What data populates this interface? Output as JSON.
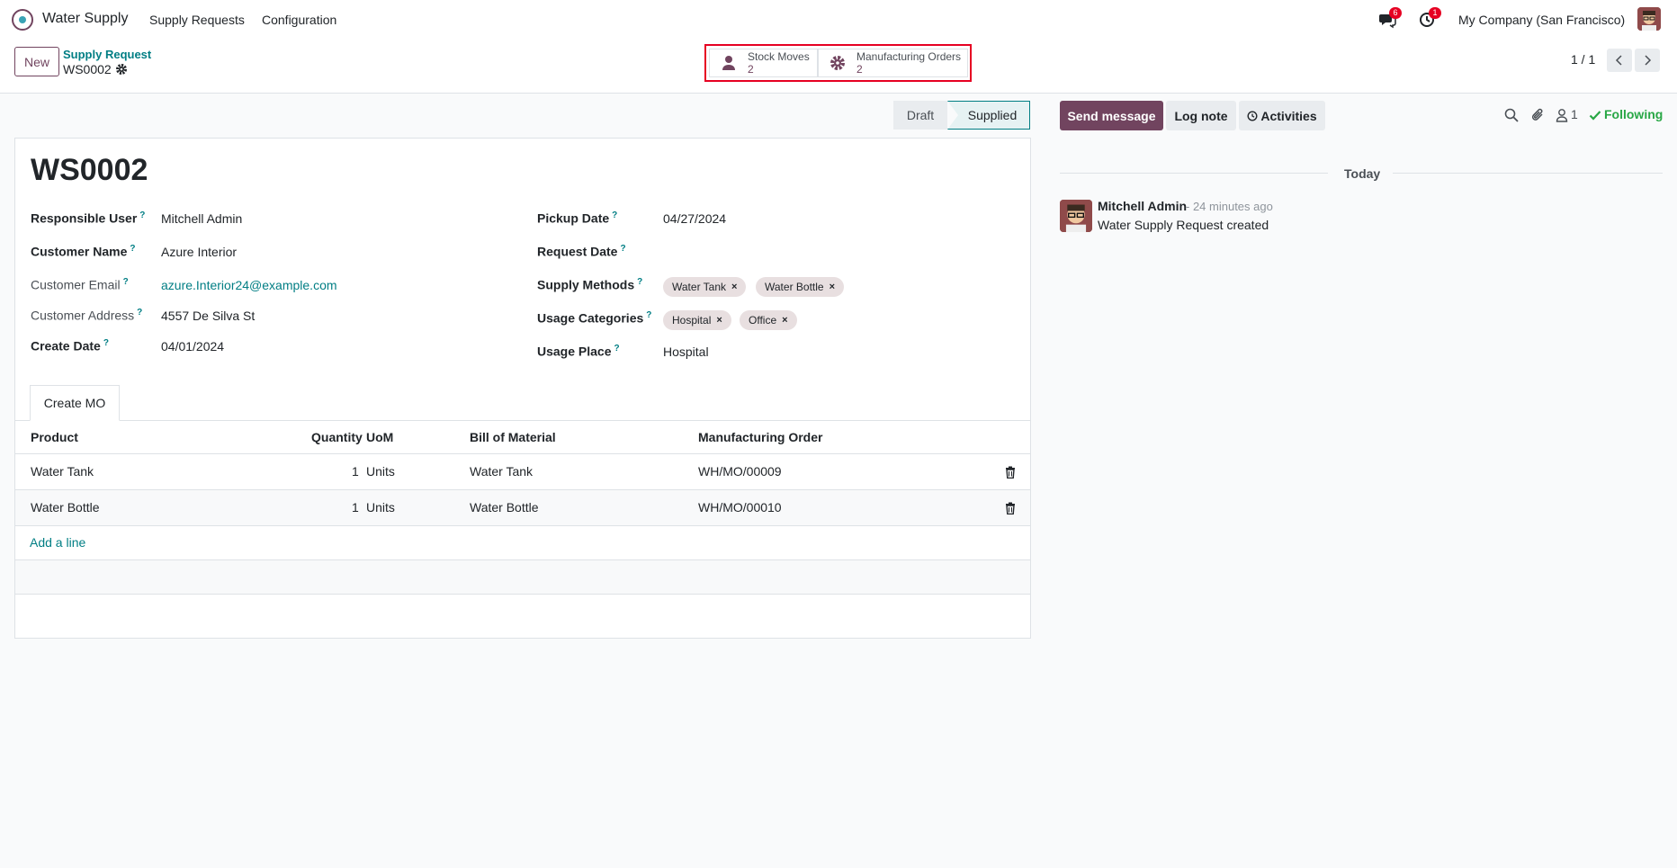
{
  "navbar": {
    "app_name": "Water Supply",
    "menus": [
      "Supply Requests",
      "Configuration"
    ],
    "messages_badge": "6",
    "activities_badge": "1",
    "company": "My Company (San Francisco)"
  },
  "control_panel": {
    "new_label": "New",
    "breadcrumb": "Supply Request",
    "record_name": "WS0002",
    "smart_buttons": [
      {
        "label": "Stock Moves",
        "value": "2",
        "icon": "user-icon"
      },
      {
        "label": "Manufacturing Orders",
        "value": "2",
        "icon": "gear-icon"
      }
    ],
    "pager": "1 / 1"
  },
  "status": {
    "stages": [
      "Draft",
      "Supplied"
    ],
    "current": "Supplied"
  },
  "form": {
    "title": "WS0002",
    "help_mark": "?",
    "left_fields": [
      {
        "label": "Responsible User",
        "value": "Mitchell Admin"
      },
      {
        "label": "Customer Name",
        "value": "Azure Interior"
      },
      {
        "label": "Customer Email",
        "value": "azure.Interior24@example.com"
      },
      {
        "label": "Customer Address",
        "value": "4557 De Silva St"
      },
      {
        "label": "Create Date",
        "value": "04/01/2024"
      }
    ],
    "right_fields": {
      "pickup_date": {
        "label": "Pickup Date",
        "value": "04/27/2024"
      },
      "request_date": {
        "label": "Request Date",
        "value": ""
      },
      "supply_methods": {
        "label": "Supply Methods",
        "tags": [
          "Water Tank",
          "Water Bottle"
        ]
      },
      "usage_categories": {
        "label": "Usage Categories",
        "tags": [
          "Hospital",
          "Office"
        ]
      },
      "usage_place": {
        "label": "Usage Place",
        "value": "Hospital"
      }
    },
    "tag_remove": "×",
    "tab": "Create MO",
    "table": {
      "headers": [
        "Product",
        "Quantity",
        "UoM",
        "Bill of Material",
        "Manufacturing Order"
      ],
      "rows": [
        {
          "product": "Water Tank",
          "quantity": "1",
          "uom": "Units",
          "bom": "Water Tank",
          "mo": "WH/MO/00009"
        },
        {
          "product": "Water Bottle",
          "quantity": "1",
          "uom": "Units",
          "bom": "Water Bottle",
          "mo": "WH/MO/00010"
        }
      ],
      "add_line": "Add a line"
    }
  },
  "chatter": {
    "send_message": "Send message",
    "log_note": "Log note",
    "activities": "Activities",
    "followers_count": "1",
    "following": "Following",
    "date_separator": "Today",
    "message": {
      "author": "Mitchell Admin",
      "time": "- 24 minutes ago",
      "body": "Water Supply Request created"
    }
  },
  "colors": {
    "brand": "#71445f",
    "link": "#017e84",
    "badge": "#e60022",
    "following": "#28a745"
  }
}
